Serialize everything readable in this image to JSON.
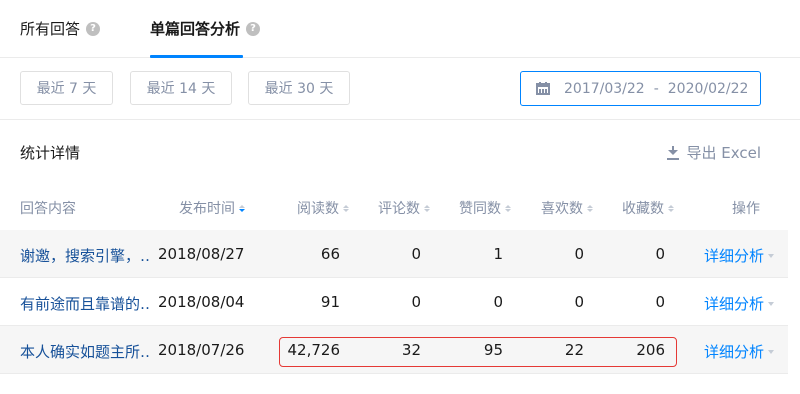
{
  "tabs": [
    {
      "label": "所有回答"
    },
    {
      "label": "单篇回答分析"
    }
  ],
  "range_buttons": [
    "最近 7 天",
    "最近 14 天",
    "最近 30 天"
  ],
  "date_range": {
    "start": "2017/03/22",
    "separator": "-",
    "end": "2020/02/22"
  },
  "stats": {
    "title": "统计详情",
    "export_label": "导出 Excel"
  },
  "table": {
    "headers": [
      "回答内容",
      "发布时间",
      "阅读数",
      "评论数",
      "赞同数",
      "喜欢数",
      "收藏数",
      "操作"
    ],
    "rows": [
      {
        "title": "谢邀，搜索引擎，…",
        "date": "2018/08/27",
        "read": "66",
        "comments": "0",
        "likes": "1",
        "favorites": "0",
        "collections": "0",
        "action": "详细分析"
      },
      {
        "title": "有前途而且靠谱的…",
        "date": "2018/08/04",
        "read": "91",
        "comments": "0",
        "likes": "0",
        "favorites": "0",
        "collections": "0",
        "action": "详细分析"
      },
      {
        "title": "本人确实如题主所…",
        "date": "2018/07/26",
        "read": "42,726",
        "comments": "32",
        "likes": "95",
        "favorites": "22",
        "collections": "206",
        "action": "详细分析"
      }
    ]
  },
  "colors": {
    "accent": "#0084ff",
    "highlight_border": "#e53935",
    "link": "#175199"
  }
}
